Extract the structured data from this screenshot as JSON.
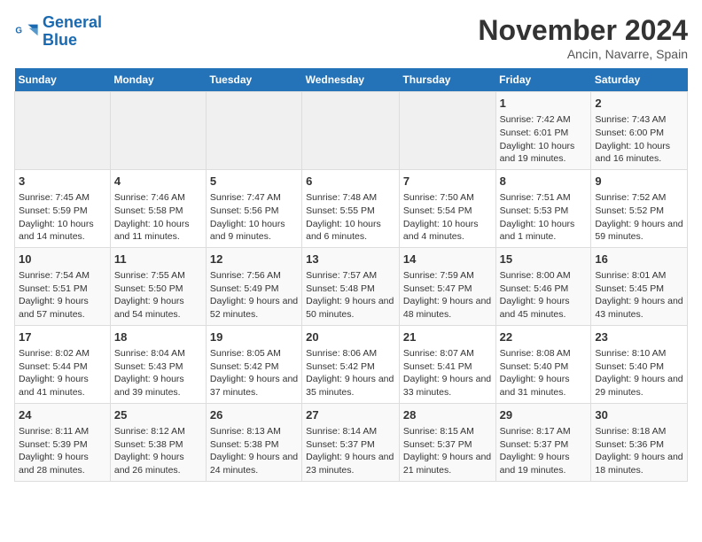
{
  "logo": {
    "line1": "General",
    "line2": "Blue"
  },
  "title": "November 2024",
  "location": "Ancin, Navarre, Spain",
  "weekdays": [
    "Sunday",
    "Monday",
    "Tuesday",
    "Wednesday",
    "Thursday",
    "Friday",
    "Saturday"
  ],
  "weeks": [
    [
      {
        "day": "",
        "info": ""
      },
      {
        "day": "",
        "info": ""
      },
      {
        "day": "",
        "info": ""
      },
      {
        "day": "",
        "info": ""
      },
      {
        "day": "",
        "info": ""
      },
      {
        "day": "1",
        "info": "Sunrise: 7:42 AM\nSunset: 6:01 PM\nDaylight: 10 hours and 19 minutes."
      },
      {
        "day": "2",
        "info": "Sunrise: 7:43 AM\nSunset: 6:00 PM\nDaylight: 10 hours and 16 minutes."
      }
    ],
    [
      {
        "day": "3",
        "info": "Sunrise: 7:45 AM\nSunset: 5:59 PM\nDaylight: 10 hours and 14 minutes."
      },
      {
        "day": "4",
        "info": "Sunrise: 7:46 AM\nSunset: 5:58 PM\nDaylight: 10 hours and 11 minutes."
      },
      {
        "day": "5",
        "info": "Sunrise: 7:47 AM\nSunset: 5:56 PM\nDaylight: 10 hours and 9 minutes."
      },
      {
        "day": "6",
        "info": "Sunrise: 7:48 AM\nSunset: 5:55 PM\nDaylight: 10 hours and 6 minutes."
      },
      {
        "day": "7",
        "info": "Sunrise: 7:50 AM\nSunset: 5:54 PM\nDaylight: 10 hours and 4 minutes."
      },
      {
        "day": "8",
        "info": "Sunrise: 7:51 AM\nSunset: 5:53 PM\nDaylight: 10 hours and 1 minute."
      },
      {
        "day": "9",
        "info": "Sunrise: 7:52 AM\nSunset: 5:52 PM\nDaylight: 9 hours and 59 minutes."
      }
    ],
    [
      {
        "day": "10",
        "info": "Sunrise: 7:54 AM\nSunset: 5:51 PM\nDaylight: 9 hours and 57 minutes."
      },
      {
        "day": "11",
        "info": "Sunrise: 7:55 AM\nSunset: 5:50 PM\nDaylight: 9 hours and 54 minutes."
      },
      {
        "day": "12",
        "info": "Sunrise: 7:56 AM\nSunset: 5:49 PM\nDaylight: 9 hours and 52 minutes."
      },
      {
        "day": "13",
        "info": "Sunrise: 7:57 AM\nSunset: 5:48 PM\nDaylight: 9 hours and 50 minutes."
      },
      {
        "day": "14",
        "info": "Sunrise: 7:59 AM\nSunset: 5:47 PM\nDaylight: 9 hours and 48 minutes."
      },
      {
        "day": "15",
        "info": "Sunrise: 8:00 AM\nSunset: 5:46 PM\nDaylight: 9 hours and 45 minutes."
      },
      {
        "day": "16",
        "info": "Sunrise: 8:01 AM\nSunset: 5:45 PM\nDaylight: 9 hours and 43 minutes."
      }
    ],
    [
      {
        "day": "17",
        "info": "Sunrise: 8:02 AM\nSunset: 5:44 PM\nDaylight: 9 hours and 41 minutes."
      },
      {
        "day": "18",
        "info": "Sunrise: 8:04 AM\nSunset: 5:43 PM\nDaylight: 9 hours and 39 minutes."
      },
      {
        "day": "19",
        "info": "Sunrise: 8:05 AM\nSunset: 5:42 PM\nDaylight: 9 hours and 37 minutes."
      },
      {
        "day": "20",
        "info": "Sunrise: 8:06 AM\nSunset: 5:42 PM\nDaylight: 9 hours and 35 minutes."
      },
      {
        "day": "21",
        "info": "Sunrise: 8:07 AM\nSunset: 5:41 PM\nDaylight: 9 hours and 33 minutes."
      },
      {
        "day": "22",
        "info": "Sunrise: 8:08 AM\nSunset: 5:40 PM\nDaylight: 9 hours and 31 minutes."
      },
      {
        "day": "23",
        "info": "Sunrise: 8:10 AM\nSunset: 5:40 PM\nDaylight: 9 hours and 29 minutes."
      }
    ],
    [
      {
        "day": "24",
        "info": "Sunrise: 8:11 AM\nSunset: 5:39 PM\nDaylight: 9 hours and 28 minutes."
      },
      {
        "day": "25",
        "info": "Sunrise: 8:12 AM\nSunset: 5:38 PM\nDaylight: 9 hours and 26 minutes."
      },
      {
        "day": "26",
        "info": "Sunrise: 8:13 AM\nSunset: 5:38 PM\nDaylight: 9 hours and 24 minutes."
      },
      {
        "day": "27",
        "info": "Sunrise: 8:14 AM\nSunset: 5:37 PM\nDaylight: 9 hours and 23 minutes."
      },
      {
        "day": "28",
        "info": "Sunrise: 8:15 AM\nSunset: 5:37 PM\nDaylight: 9 hours and 21 minutes."
      },
      {
        "day": "29",
        "info": "Sunrise: 8:17 AM\nSunset: 5:37 PM\nDaylight: 9 hours and 19 minutes."
      },
      {
        "day": "30",
        "info": "Sunrise: 8:18 AM\nSunset: 5:36 PM\nDaylight: 9 hours and 18 minutes."
      }
    ]
  ]
}
